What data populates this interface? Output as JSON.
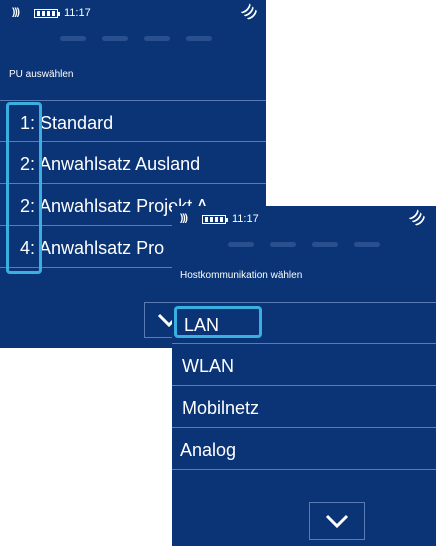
{
  "screen1": {
    "status": {
      "time": "11:17"
    },
    "title": "PU auswählen",
    "items": [
      {
        "num": "1:",
        "label": "Standard"
      },
      {
        "num": "2:",
        "label": "Anwahlsatz Ausland"
      },
      {
        "num": "2:",
        "label": "Anwahlsatz Projekt A"
      },
      {
        "num": "4:",
        "label": "Anwahlsatz Pro"
      }
    ],
    "highlight_color": "#3ab0e2"
  },
  "screen2": {
    "status": {
      "time": "11:17"
    },
    "title": "Hostkommunikation wählen",
    "items": [
      {
        "label": "LAN"
      },
      {
        "label": "WLAN"
      },
      {
        "label": "Mobilnetz"
      },
      {
        "label": "Analog"
      }
    ],
    "highlighted_item": "LAN",
    "highlight_color": "#3ab0e2"
  },
  "colors": {
    "background": "#0a3476",
    "divider": "#5a7bb3",
    "accent": "#3ab0e2"
  },
  "icons": [
    "nfc-icon",
    "battery-icon",
    "wifi-icon",
    "chevron-down-icon"
  ]
}
